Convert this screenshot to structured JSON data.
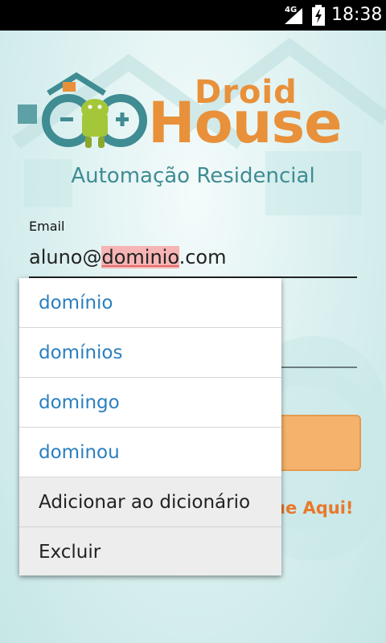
{
  "status_bar": {
    "network": "4G",
    "time": "18:38"
  },
  "logo": {
    "line1": "Droid",
    "line2": "House"
  },
  "subtitle": "Automação Residencial",
  "form": {
    "email_label": "Email",
    "email_value_before": "aluno@",
    "email_value_highlight": "dominio",
    "email_value_after": ".com",
    "register_link_visible": "ue Aqui!"
  },
  "suggestions": {
    "words": [
      "domínio",
      "domínios",
      "domingo",
      "dominou"
    ],
    "actions": [
      "Adicionar ao dicionário",
      "Excluir"
    ]
  },
  "colors": {
    "brand_orange": "#e8913a",
    "teal": "#3f8c93",
    "suggestion_blue": "#2a7fbf"
  }
}
